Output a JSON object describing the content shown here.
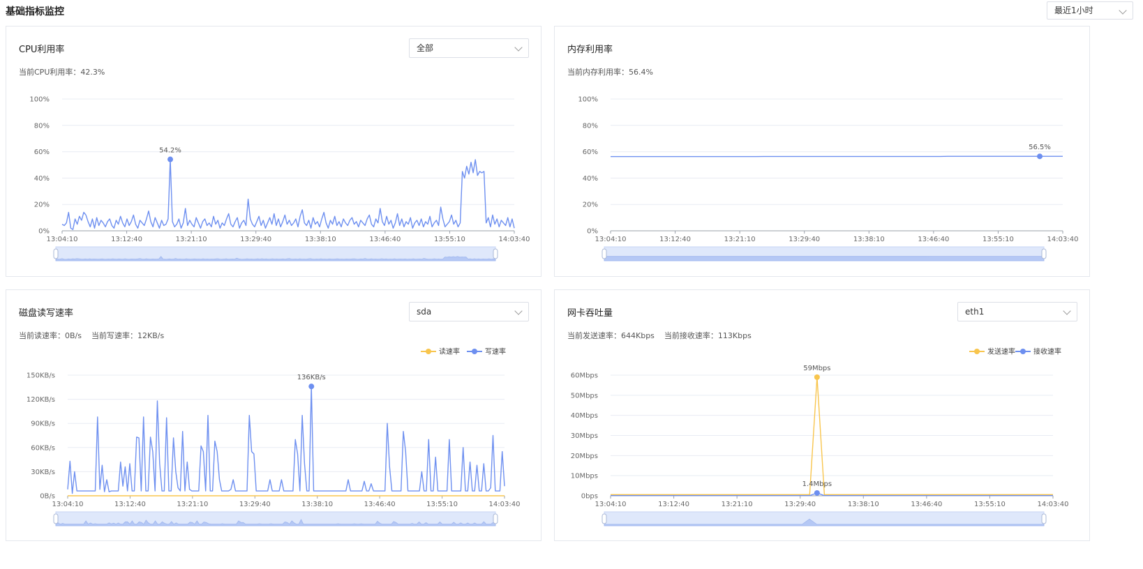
{
  "page": {
    "title": "基础指标监控",
    "time_range": "最近1小时"
  },
  "panels": {
    "cpu": {
      "title": "CPU利用率",
      "select_value": "全部",
      "current_label": "当前CPU利用率：",
      "current_value": "42.3%"
    },
    "memory": {
      "title": "内存利用率",
      "current_label": "当前内存利用率：",
      "current_value": "56.4%"
    },
    "disk": {
      "title": "磁盘读写速率",
      "select_value": "sda",
      "read_label": "当前读速率：",
      "read_value": "0B/s",
      "write_label": "当前写速率：",
      "write_value": "12KB/s"
    },
    "network": {
      "title": "网卡吞吐量",
      "select_value": "eth1",
      "send_label": "当前发送速率：",
      "send_value": "644Kbps",
      "recv_label": "当前接收速率：",
      "recv_value": "113Kbps"
    }
  },
  "colors": {
    "blue": "#6d8ff0",
    "yellow": "#f8c54d",
    "grid": "#e8ecf3",
    "axis": "#9aa0aa",
    "slider_bg": "#dfe8fb",
    "slider_area": "#b5c8f5"
  },
  "icons": {
    "dropdown": "chevron-down-icon"
  },
  "chart_data": [
    {
      "id": "cpu",
      "type": "line",
      "x_ticks": [
        "13:04:10",
        "13:12:40",
        "13:21:10",
        "13:29:40",
        "13:38:10",
        "13:46:40",
        "13:55:10",
        "14:03:40"
      ],
      "y_ticks": [
        "0%",
        "20%",
        "40%",
        "60%",
        "80%",
        "100%"
      ],
      "ylim": [
        0,
        100
      ],
      "series": [
        {
          "color": "#6d8ff0",
          "values": [
            5,
            4,
            6,
            14,
            2,
            1,
            9,
            5,
            11,
            8,
            14,
            12,
            7,
            3,
            9,
            2,
            10,
            4,
            8,
            6,
            3,
            7,
            9,
            4,
            2,
            8,
            5,
            11,
            6,
            3,
            9,
            4,
            7,
            12,
            5,
            2,
            8,
            6,
            4,
            9,
            15,
            7,
            3,
            10,
            6,
            2,
            8,
            4,
            5,
            9,
            54.2,
            7,
            3,
            5,
            9,
            2,
            6,
            17,
            4,
            8,
            5,
            3,
            10,
            6,
            2,
            7,
            9,
            4,
            6,
            3,
            11,
            5,
            8,
            2,
            6,
            4,
            9,
            13,
            5,
            3,
            7,
            10,
            2,
            6,
            8,
            4,
            24,
            9,
            5,
            3,
            7,
            11,
            4,
            8,
            2,
            6,
            10,
            5,
            13,
            4,
            9,
            3,
            7,
            12,
            5,
            8,
            4,
            6,
            9,
            3,
            11,
            16,
            6,
            4,
            8,
            2,
            10,
            5,
            7,
            3,
            9,
            14,
            6,
            2,
            8,
            5,
            11,
            4,
            7,
            3,
            9,
            6,
            4,
            8,
            10,
            5,
            7,
            3,
            8,
            6,
            4,
            9,
            12,
            5,
            3,
            9,
            6,
            17,
            7,
            4,
            11,
            5,
            8,
            2,
            6,
            13,
            4,
            9,
            3,
            7,
            5,
            10,
            2,
            6,
            8,
            4,
            9,
            3,
            7,
            5,
            11,
            3,
            6,
            8,
            4,
            18,
            9,
            3,
            5,
            7,
            12,
            5,
            8,
            3,
            6,
            45,
            40,
            49,
            43,
            52,
            44,
            54,
            42,
            45,
            44,
            45,
            6,
            10,
            3,
            12,
            5,
            9,
            3,
            8,
            6,
            4,
            10,
            3,
            9,
            2
          ],
          "highlight": {
            "index": 50,
            "value": 54.2,
            "label": "54.2%"
          }
        }
      ]
    },
    {
      "id": "memory",
      "type": "line",
      "x_ticks": [
        "13:04:10",
        "13:12:40",
        "13:21:10",
        "13:29:40",
        "13:38:10",
        "13:46:40",
        "13:55:10",
        "14:03:40"
      ],
      "y_ticks": [
        "0%",
        "20%",
        "40%",
        "60%",
        "80%",
        "100%"
      ],
      "ylim": [
        0,
        100
      ],
      "series": [
        {
          "color": "#6d8ff0",
          "values": [
            56.3,
            56.3,
            56.3,
            56.3,
            56.3,
            56.3,
            56.3,
            56.3,
            56.3,
            56.3,
            56.3,
            56.3,
            56.3,
            56.3,
            56.3,
            56.3,
            56.3,
            56.3,
            56.3,
            56.3,
            56.4,
            56.4,
            56.4,
            56.4,
            56.4,
            56.4,
            56.4,
            56.4,
            56.4,
            56.4,
            56.4,
            56.4,
            56.4,
            56.4,
            56.4,
            56.4,
            56.4,
            56.4,
            56.4,
            56.4,
            56.4,
            56.4,
            56.4,
            56.4,
            56.5,
            56.5,
            56.5,
            56.5,
            56.5,
            56.5,
            56.5,
            56.5,
            56.5,
            56.5,
            56.5,
            56.5,
            56.5,
            56.5,
            56.5,
            56.5
          ],
          "highlight": {
            "index": 56,
            "value": 56.5,
            "label": "56.5%"
          }
        }
      ]
    },
    {
      "id": "disk",
      "type": "line",
      "x_ticks": [
        "13:04:10",
        "13:12:40",
        "13:21:10",
        "13:29:40",
        "13:38:10",
        "13:46:40",
        "13:55:10",
        "14:03:40"
      ],
      "y_ticks": [
        "0B/s",
        "30KB/s",
        "60KB/s",
        "90KB/s",
        "120KB/s",
        "150KB/s"
      ],
      "ylim": [
        0,
        150
      ],
      "series": [
        {
          "name": "读速率",
          "color": "#f8c54d",
          "values": [
            0,
            0,
            0,
            0,
            0,
            0,
            0,
            0,
            0,
            0,
            0,
            0,
            0,
            0,
            0,
            0,
            0,
            0,
            0,
            0
          ]
        },
        {
          "name": "写速率",
          "color": "#6d8ff0",
          "values": [
            8,
            43,
            3,
            30,
            6,
            6,
            6,
            6,
            6,
            6,
            6,
            6,
            6,
            98,
            8,
            38,
            5,
            20,
            5,
            6,
            6,
            6,
            6,
            42,
            12,
            36,
            6,
            40,
            6,
            6,
            73,
            72,
            6,
            98,
            6,
            6,
            73,
            55,
            6,
            118,
            40,
            6,
            6,
            97,
            6,
            6,
            72,
            30,
            10,
            6,
            80,
            6,
            42,
            8,
            6,
            6,
            6,
            6,
            62,
            55,
            6,
            100,
            6,
            6,
            68,
            55,
            20,
            6,
            6,
            6,
            6,
            8,
            20,
            6,
            6,
            6,
            6,
            6,
            6,
            100,
            55,
            52,
            6,
            6,
            6,
            6,
            6,
            6,
            20,
            6,
            6,
            6,
            6,
            20,
            6,
            6,
            6,
            6,
            6,
            70,
            52,
            6,
            100,
            40,
            6,
            6,
            136,
            6,
            6,
            6,
            6,
            6,
            6,
            6,
            6,
            6,
            6,
            6,
            6,
            6,
            6,
            6,
            20,
            6,
            6,
            6,
            6,
            6,
            6,
            18,
            6,
            6,
            15,
            6,
            6,
            6,
            6,
            6,
            6,
            90,
            36,
            6,
            6,
            6,
            6,
            6,
            80,
            55,
            6,
            6,
            6,
            6,
            6,
            6,
            30,
            6,
            6,
            70,
            6,
            6,
            48,
            6,
            6,
            6,
            6,
            6,
            70,
            6,
            6,
            6,
            6,
            6,
            60,
            6,
            6,
            42,
            6,
            6,
            38,
            6,
            6,
            40,
            6,
            6,
            10,
            75,
            6,
            6,
            6,
            55,
            12
          ],
          "highlight": {
            "index": 106,
            "value": 136,
            "label": "136KB/s"
          }
        }
      ]
    },
    {
      "id": "network",
      "type": "line",
      "x_ticks": [
        "13:04:10",
        "13:12:40",
        "13:21:10",
        "13:29:40",
        "13:38:10",
        "13:46:40",
        "13:55:10",
        "14:03:40"
      ],
      "y_ticks": [
        "0bps",
        "10Mbps",
        "20Mbps",
        "30Mbps",
        "40Mbps",
        "50Mbps",
        "60Mbps"
      ],
      "ylim": [
        0,
        60
      ],
      "series": [
        {
          "name": "发送速率",
          "color": "#f8c54d",
          "values": [
            0.6,
            0.6,
            0.6,
            0.6,
            0.6,
            0.6,
            0.6,
            0.6,
            0.6,
            0.6,
            0.6,
            0.6,
            0.6,
            0.6,
            0.6,
            0.6,
            0.6,
            0.6,
            0.6,
            0.6,
            0.6,
            0.6,
            0.6,
            0.6,
            0.6,
            0.6,
            0.6,
            0.6,
            59,
            0.6,
            0.6,
            0.6,
            0.6,
            0.6,
            0.6,
            0.6,
            0.6,
            0.6,
            0.6,
            0.6,
            0.6,
            0.6,
            0.6,
            0.6,
            0.6,
            0.6,
            0.6,
            0.6,
            0.6,
            0.6,
            0.6,
            0.6,
            0.6,
            0.6,
            0.6,
            0.6,
            0.6,
            0.6,
            0.6,
            0.6,
            0.6
          ],
          "highlight": {
            "index": 28,
            "value": 59,
            "label": "59Mbps"
          }
        },
        {
          "name": "接收速率",
          "color": "#6d8ff0",
          "values": [
            0.1,
            0.1,
            0.1,
            0.1,
            0.1,
            0.1,
            0.1,
            0.1,
            0.1,
            0.1,
            0.1,
            0.1,
            0.1,
            0.1,
            0.1,
            0.1,
            0.1,
            0.1,
            0.1,
            0.1,
            0.1,
            0.1,
            0.1,
            0.1,
            0.1,
            0.1,
            0.1,
            0.1,
            1.4,
            0.1,
            0.1,
            0.1,
            0.1,
            0.1,
            0.1,
            0.1,
            0.1,
            0.1,
            0.1,
            0.1,
            0.1,
            0.1,
            0.1,
            0.1,
            0.1,
            0.1,
            0.1,
            0.1,
            0.1,
            0.1,
            0.1,
            0.1,
            0.1,
            0.1,
            0.1,
            0.1,
            0.1,
            0.1,
            0.1,
            0.1,
            0.1
          ],
          "highlight": {
            "index": 28,
            "value": 1.4,
            "label": "1.4Mbps"
          }
        }
      ]
    }
  ]
}
